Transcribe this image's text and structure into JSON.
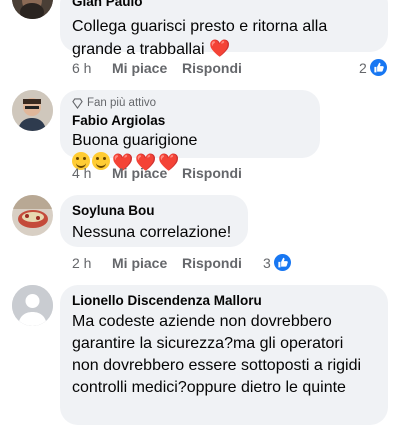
{
  "comments": [
    {
      "author": "Gian Paulo",
      "text": "Collega guarisci presto e ritorna alla grande a trabballai",
      "emoji": [
        "heart"
      ],
      "time": "6 h",
      "like_label": "Mi piace",
      "reply_label": "Rispondi",
      "reactions": "2"
    },
    {
      "badge": "Fan più attivo",
      "author": "Fabio Argiolas",
      "text": "Buona guarigione",
      "emoji": [
        "smirk",
        "grin",
        "heart",
        "heart",
        "heart"
      ],
      "time": "4 h",
      "like_label": "Mi piace",
      "reply_label": "Rispondi"
    },
    {
      "author": "Soyluna Bou",
      "text": "Nessuna correlazione!",
      "time": "2 h",
      "like_label": "Mi piace",
      "reply_label": "Rispondi",
      "reactions": "3"
    },
    {
      "author": "Lionello Discendenza Malloru",
      "text_lines": [
        "Ma codeste aziende non dovrebbero",
        "garantire la sicurezza?ma gli operatori",
        "non dovrebbero essere sottoposti a rigidi",
        "controlli medici?oppure dietro le quinte"
      ]
    }
  ],
  "colors": {
    "accent": "#1877f2",
    "bubble": "#f0f2f5",
    "meta": "#65676b",
    "heart": "#e41e3f"
  }
}
